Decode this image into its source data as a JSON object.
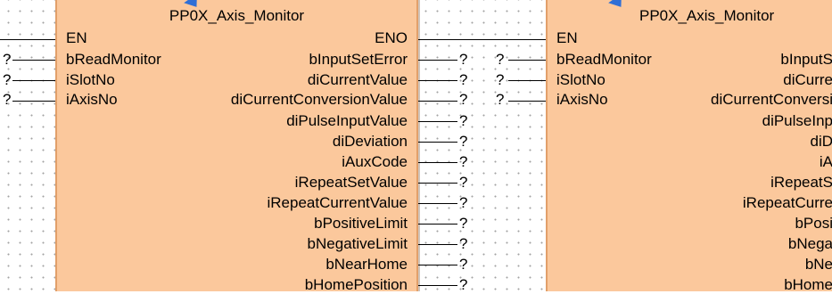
{
  "block1": {
    "title": "PP0X_Axis_Monitor",
    "inputs": [
      "EN",
      "bReadMonitor",
      "iSlotNo",
      "iAxisNo"
    ],
    "outputs": [
      "ENO",
      "bInputSetError",
      "diCurrentValue",
      "diCurrentConversionValue",
      "diPulseInputValue",
      "diDeviation",
      "iAuxCode",
      "iRepeatSetValue",
      "iRepeatCurrentValue",
      "bPositiveLimit",
      "bNegativeLimit",
      "bNearHome",
      "bHomePosition"
    ],
    "input_values": [
      "",
      "?",
      "?",
      "?"
    ],
    "output_values": [
      "",
      "?",
      "?",
      "?",
      "?",
      "?",
      "?",
      "?",
      "?",
      "?",
      "?",
      "?",
      "?"
    ]
  },
  "block2": {
    "title": "PP0X_Axis_Monitor",
    "inputs": [
      "EN",
      "bReadMonitor",
      "iSlotNo",
      "iAxisNo"
    ],
    "input_values": [
      "",
      "?",
      "?",
      "?"
    ],
    "outputs_visible": [
      "",
      "bInputS",
      "diCurre",
      "diCurrentConversi",
      "diPulseInp",
      "diD",
      "iA",
      "iRepeatS",
      "iRepeatCurre",
      "bPosi",
      "bNega",
      "bNe",
      "bHome"
    ]
  },
  "colors": {
    "block_fill": "#fbc89c",
    "block_border": "#e2a06a",
    "arrow": "#2f6fd6",
    "grid_dot": "#a3a3a3"
  }
}
